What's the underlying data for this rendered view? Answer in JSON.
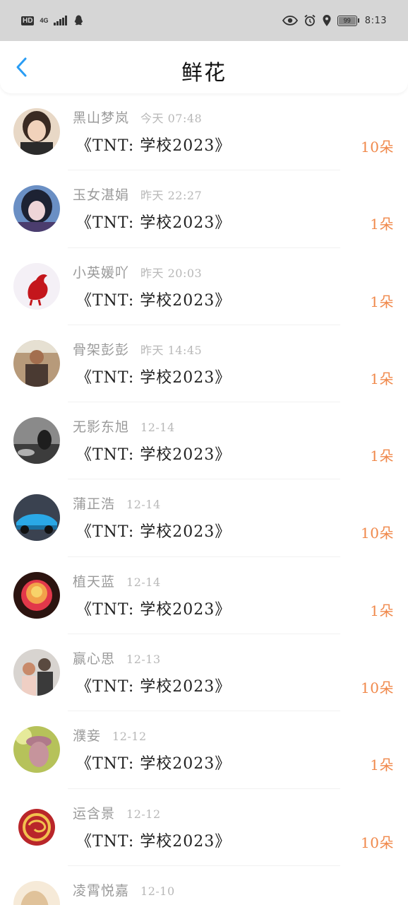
{
  "status_bar": {
    "hd": "HD",
    "network": "4G",
    "battery": "99",
    "time": "8:13"
  },
  "header": {
    "title": "鲜花"
  },
  "colors": {
    "accent_blue": "#2a9df4",
    "amount_orange": "#f0884a",
    "status_bar_bg": "#d6d6d6"
  },
  "items": [
    {
      "name": "黑山梦岚",
      "time": "今天 07:48",
      "gift": "《TNT: 学校2023》",
      "amount": "10朵"
    },
    {
      "name": "玉女湛娟",
      "time": "昨天 22:27",
      "gift": "《TNT: 学校2023》",
      "amount": "1朵"
    },
    {
      "name": "小英媛吖",
      "time": "昨天 20:03",
      "gift": "《TNT: 学校2023》",
      "amount": "1朵"
    },
    {
      "name": "骨架彭彭",
      "time": "昨天 14:45",
      "gift": "《TNT: 学校2023》",
      "amount": "1朵"
    },
    {
      "name": "无影东旭",
      "time": "12-14",
      "gift": "《TNT: 学校2023》",
      "amount": "1朵"
    },
    {
      "name": "蒲正浩",
      "time": "12-14",
      "gift": "《TNT: 学校2023》",
      "amount": "10朵"
    },
    {
      "name": "植天蓝",
      "time": "12-14",
      "gift": "《TNT: 学校2023》",
      "amount": "1朵"
    },
    {
      "name": "赢心思",
      "time": "12-13",
      "gift": "《TNT: 学校2023》",
      "amount": "10朵"
    },
    {
      "name": "濮妾",
      "time": "12-12",
      "gift": "《TNT: 学校2023》",
      "amount": "1朵"
    },
    {
      "name": "运含景",
      "time": "12-12",
      "gift": "《TNT: 学校2023》",
      "amount": "10朵"
    },
    {
      "name": "凌霄悦嘉",
      "time": "12-10",
      "gift": "",
      "amount": ""
    }
  ]
}
